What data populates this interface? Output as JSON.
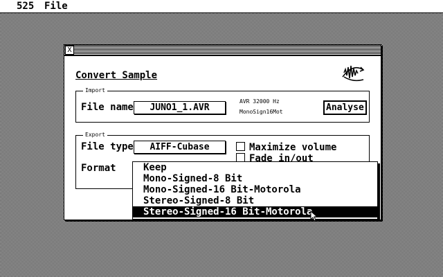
{
  "menubar": {
    "app": "525",
    "file": "File"
  },
  "dialog": {
    "close_glyph": "X",
    "title": "Convert Sample",
    "import": {
      "label": "Import",
      "filename_label": "File name",
      "filename_value": "JUNO1_1.AVR",
      "info_line1": "AVR 32000 Hz",
      "info_line2": "MonoSign16Mot",
      "analyse_label": "Analyse"
    },
    "export": {
      "label": "Export",
      "filetype_label": "File type",
      "filetype_value": "AIFF-Cubase",
      "format_label": "Format",
      "maximize_label": "Maximize volume",
      "fade_label": "Fade in/out"
    }
  },
  "format_popup": {
    "items": [
      "Keep",
      "Mono-Signed-8 Bit",
      "Mono-Signed-16 Bit-Motorola",
      "Stereo-Signed-8 Bit",
      "Stereo-Signed-16 Bit-Motorola"
    ],
    "selected_index": 4
  }
}
